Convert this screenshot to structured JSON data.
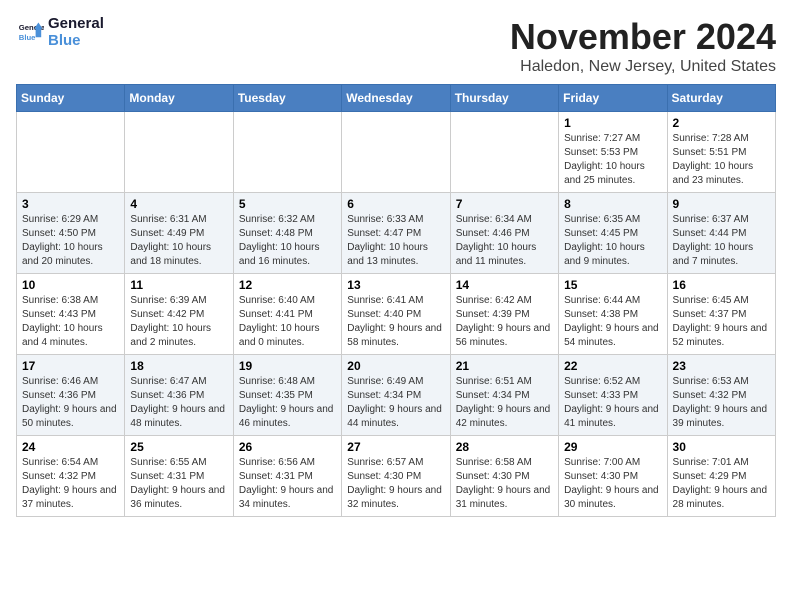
{
  "logo": {
    "line1": "General",
    "line2": "Blue"
  },
  "header": {
    "month": "November 2024",
    "location": "Haledon, New Jersey, United States"
  },
  "weekdays": [
    "Sunday",
    "Monday",
    "Tuesday",
    "Wednesday",
    "Thursday",
    "Friday",
    "Saturday"
  ],
  "weeks": [
    [
      {
        "day": "",
        "info": ""
      },
      {
        "day": "",
        "info": ""
      },
      {
        "day": "",
        "info": ""
      },
      {
        "day": "",
        "info": ""
      },
      {
        "day": "",
        "info": ""
      },
      {
        "day": "1",
        "info": "Sunrise: 7:27 AM\nSunset: 5:53 PM\nDaylight: 10 hours and 25 minutes."
      },
      {
        "day": "2",
        "info": "Sunrise: 7:28 AM\nSunset: 5:51 PM\nDaylight: 10 hours and 23 minutes."
      }
    ],
    [
      {
        "day": "3",
        "info": "Sunrise: 6:29 AM\nSunset: 4:50 PM\nDaylight: 10 hours and 20 minutes."
      },
      {
        "day": "4",
        "info": "Sunrise: 6:31 AM\nSunset: 4:49 PM\nDaylight: 10 hours and 18 minutes."
      },
      {
        "day": "5",
        "info": "Sunrise: 6:32 AM\nSunset: 4:48 PM\nDaylight: 10 hours and 16 minutes."
      },
      {
        "day": "6",
        "info": "Sunrise: 6:33 AM\nSunset: 4:47 PM\nDaylight: 10 hours and 13 minutes."
      },
      {
        "day": "7",
        "info": "Sunrise: 6:34 AM\nSunset: 4:46 PM\nDaylight: 10 hours and 11 minutes."
      },
      {
        "day": "8",
        "info": "Sunrise: 6:35 AM\nSunset: 4:45 PM\nDaylight: 10 hours and 9 minutes."
      },
      {
        "day": "9",
        "info": "Sunrise: 6:37 AM\nSunset: 4:44 PM\nDaylight: 10 hours and 7 minutes."
      }
    ],
    [
      {
        "day": "10",
        "info": "Sunrise: 6:38 AM\nSunset: 4:43 PM\nDaylight: 10 hours and 4 minutes."
      },
      {
        "day": "11",
        "info": "Sunrise: 6:39 AM\nSunset: 4:42 PM\nDaylight: 10 hours and 2 minutes."
      },
      {
        "day": "12",
        "info": "Sunrise: 6:40 AM\nSunset: 4:41 PM\nDaylight: 10 hours and 0 minutes."
      },
      {
        "day": "13",
        "info": "Sunrise: 6:41 AM\nSunset: 4:40 PM\nDaylight: 9 hours and 58 minutes."
      },
      {
        "day": "14",
        "info": "Sunrise: 6:42 AM\nSunset: 4:39 PM\nDaylight: 9 hours and 56 minutes."
      },
      {
        "day": "15",
        "info": "Sunrise: 6:44 AM\nSunset: 4:38 PM\nDaylight: 9 hours and 54 minutes."
      },
      {
        "day": "16",
        "info": "Sunrise: 6:45 AM\nSunset: 4:37 PM\nDaylight: 9 hours and 52 minutes."
      }
    ],
    [
      {
        "day": "17",
        "info": "Sunrise: 6:46 AM\nSunset: 4:36 PM\nDaylight: 9 hours and 50 minutes."
      },
      {
        "day": "18",
        "info": "Sunrise: 6:47 AM\nSunset: 4:36 PM\nDaylight: 9 hours and 48 minutes."
      },
      {
        "day": "19",
        "info": "Sunrise: 6:48 AM\nSunset: 4:35 PM\nDaylight: 9 hours and 46 minutes."
      },
      {
        "day": "20",
        "info": "Sunrise: 6:49 AM\nSunset: 4:34 PM\nDaylight: 9 hours and 44 minutes."
      },
      {
        "day": "21",
        "info": "Sunrise: 6:51 AM\nSunset: 4:34 PM\nDaylight: 9 hours and 42 minutes."
      },
      {
        "day": "22",
        "info": "Sunrise: 6:52 AM\nSunset: 4:33 PM\nDaylight: 9 hours and 41 minutes."
      },
      {
        "day": "23",
        "info": "Sunrise: 6:53 AM\nSunset: 4:32 PM\nDaylight: 9 hours and 39 minutes."
      }
    ],
    [
      {
        "day": "24",
        "info": "Sunrise: 6:54 AM\nSunset: 4:32 PM\nDaylight: 9 hours and 37 minutes."
      },
      {
        "day": "25",
        "info": "Sunrise: 6:55 AM\nSunset: 4:31 PM\nDaylight: 9 hours and 36 minutes."
      },
      {
        "day": "26",
        "info": "Sunrise: 6:56 AM\nSunset: 4:31 PM\nDaylight: 9 hours and 34 minutes."
      },
      {
        "day": "27",
        "info": "Sunrise: 6:57 AM\nSunset: 4:30 PM\nDaylight: 9 hours and 32 minutes."
      },
      {
        "day": "28",
        "info": "Sunrise: 6:58 AM\nSunset: 4:30 PM\nDaylight: 9 hours and 31 minutes."
      },
      {
        "day": "29",
        "info": "Sunrise: 7:00 AM\nSunset: 4:30 PM\nDaylight: 9 hours and 30 minutes."
      },
      {
        "day": "30",
        "info": "Sunrise: 7:01 AM\nSunset: 4:29 PM\nDaylight: 9 hours and 28 minutes."
      }
    ]
  ]
}
